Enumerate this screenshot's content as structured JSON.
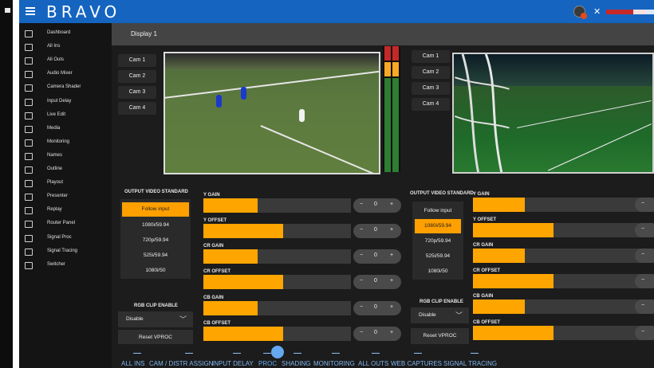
{
  "app": {
    "brand": "BRAVO",
    "content_title": "Display 1"
  },
  "sidebar": {
    "items": [
      {
        "label": "Dashboard",
        "icon": "dashboard-icon"
      },
      {
        "label": "All Ins",
        "icon": "inputs-icon"
      },
      {
        "label": "All Outs",
        "icon": "outputs-icon"
      },
      {
        "label": "Audio Mixer",
        "icon": "audio-mixer-icon"
      },
      {
        "label": "Camera Shader",
        "icon": "camera-shader-icon"
      },
      {
        "label": "Input Delay",
        "icon": "clock-icon"
      },
      {
        "label": "Live Edit",
        "icon": "live-edit-icon"
      },
      {
        "label": "Media",
        "icon": "media-play-icon"
      },
      {
        "label": "Monitoring",
        "icon": "monitoring-icon"
      },
      {
        "label": "Names",
        "icon": "names-icon"
      },
      {
        "label": "Outline",
        "icon": "outline-icon"
      },
      {
        "label": "Playout",
        "icon": "playout-icon"
      },
      {
        "label": "Presenter",
        "icon": "presenter-icon"
      },
      {
        "label": "Replay",
        "icon": "replay-icon"
      },
      {
        "label": "Router Panel",
        "icon": "router-panel-icon"
      },
      {
        "label": "Signal Proc",
        "icon": "signal-proc-icon"
      },
      {
        "label": "Signal Tracing",
        "icon": "signal-tracing-icon"
      },
      {
        "label": "Switcher",
        "icon": "switcher-icon"
      }
    ]
  },
  "cameras_left": [
    "Cam 1",
    "Cam 2",
    "Cam 3",
    "Cam 4"
  ],
  "cameras_right": [
    "Cam 1",
    "Cam 2",
    "Cam 3",
    "Cam 4"
  ],
  "left_panel": {
    "output_label": "OUTPUT VIDEO STANDARD",
    "standards": [
      "Follow input",
      "1080i/59.94",
      "720p/59.94",
      "525i/59.94",
      "1080i/50"
    ],
    "selected_index": 0,
    "rgb_clip_label": "RGB CLIP ENABLE",
    "rgb_clip_value": "Disable",
    "reset_label": "Reset VPROC",
    "controls": [
      {
        "label": "Y GAIN",
        "fill": 0.37,
        "value": "0"
      },
      {
        "label": "Y OFFSET",
        "fill": 0.54,
        "value": "0"
      },
      {
        "label": "CR GAIN",
        "fill": 0.37,
        "value": "0"
      },
      {
        "label": "CR OFFSET",
        "fill": 0.54,
        "value": "0"
      },
      {
        "label": "CB GAIN",
        "fill": 0.37,
        "value": "0"
      },
      {
        "label": "CB OFFSET",
        "fill": 0.54,
        "value": "0"
      }
    ],
    "minus": "−",
    "plus": "+"
  },
  "right_panel": {
    "output_label": "OUTPUT VIDEO STANDARD",
    "standards": [
      "Follow input",
      "1080i/59.94",
      "720p/59.94",
      "525i/59.94",
      "1080i/50"
    ],
    "selected_index": 1,
    "rgb_clip_label": "RGB CLIP ENABLE",
    "rgb_clip_value": "Disable",
    "reset_label": "Reset VPROC",
    "controls": [
      {
        "label": "Y GAIN"
      },
      {
        "label": "Y OFFSET"
      },
      {
        "label": "CR GAIN"
      },
      {
        "label": "CR OFFSET"
      },
      {
        "label": "CB GAIN"
      },
      {
        "label": "CB OFFSET"
      }
    ],
    "minus": "−"
  },
  "bottom_bar": [
    {
      "label": "ALL INS",
      "icon": "all-ins-icon"
    },
    {
      "label": "CAM / DISTR ASSIGN",
      "icon": "cam-assign-icon"
    },
    {
      "label": "INPUT DELAY",
      "icon": "input-delay-icon"
    },
    {
      "label": "PROC",
      "icon": "proc-icon"
    },
    {
      "label": "SHADING",
      "icon": "shading-icon"
    },
    {
      "label": "MONITORING",
      "icon": "monitoring-icon"
    },
    {
      "label": "ALL OUTS",
      "icon": "all-outs-icon"
    },
    {
      "label": "WEB CAPTURES",
      "icon": "web-captures-icon"
    },
    {
      "label": "SIGNAL TRACING",
      "icon": "signal-tracing-icon"
    }
  ],
  "colors": {
    "topbar": "#1565c0",
    "accent": "#ffa500",
    "bottom_label": "#7fb6ee",
    "active_tab": "#64a8f0"
  }
}
